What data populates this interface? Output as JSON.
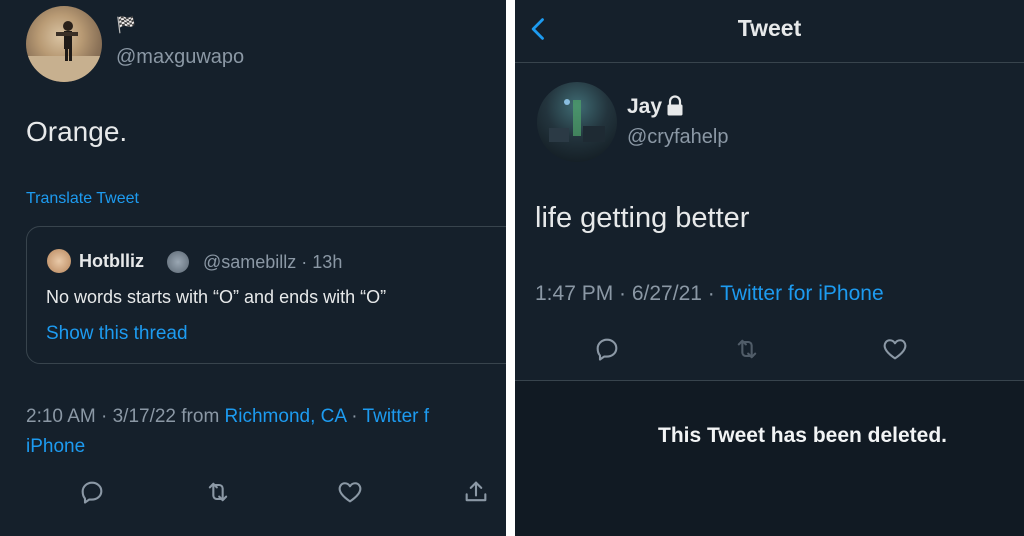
{
  "left_tweet": {
    "flag_glyph": "🏁",
    "handle": "@maxguwapo",
    "text": "Orange.",
    "translate": "Translate Tweet",
    "quote": {
      "name": "Hotblliz",
      "handle_time": "@samebillz · 13h",
      "text": "No words starts with “O” and ends with “O”",
      "show_thread": "Show this thread"
    },
    "meta": {
      "time_date": "2:10 AM · 3/17/22 from ",
      "location": "Richmond, CA",
      "sep": " · ",
      "client_part1": "Twitter f",
      "client_part2": "iPhone"
    },
    "actions": [
      "reply-icon",
      "retweet-icon",
      "like-icon",
      "share-icon"
    ]
  },
  "right_tweet": {
    "header_title": "Tweet",
    "back_icon": "chevron-left-icon",
    "name": "Jay",
    "lock_icon": "lock-icon",
    "handle": "@cryfahelp",
    "text": "life getting better",
    "meta": {
      "time_date": "1:47 PM · 6/27/21 · ",
      "client": "Twitter for iPhone"
    },
    "actions": [
      "reply-icon",
      "retweet-icon",
      "like-icon"
    ],
    "deleted_notice": "This Tweet has been deleted."
  },
  "colors": {
    "background": "#15202b",
    "text": "#e7e9ea",
    "muted": "#8b98a5",
    "accent": "#1d9bf0",
    "border": "#38444d"
  }
}
